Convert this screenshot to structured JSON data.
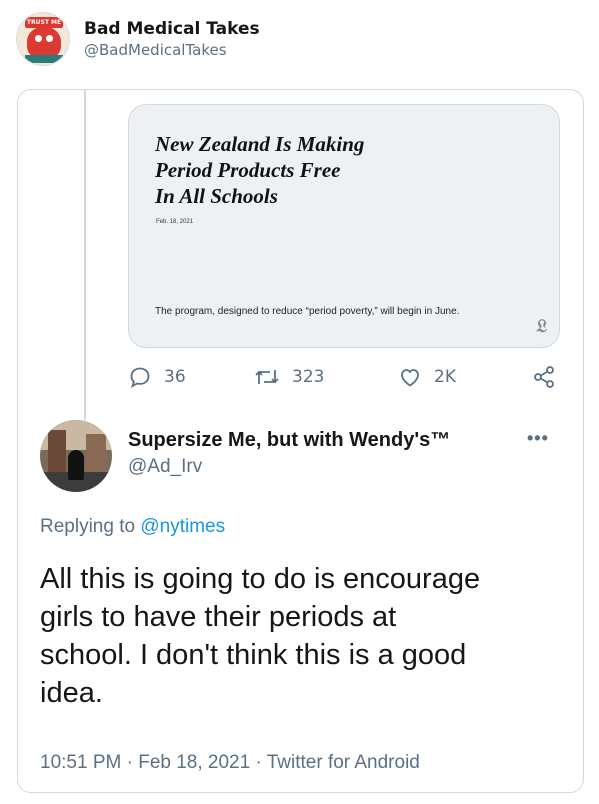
{
  "outer": {
    "name": "Bad Medical Takes",
    "handle": "@BadMedicalTakes",
    "avatar_cap_text": "TRUST ME"
  },
  "article": {
    "title_lines": [
      "New Zealand Is Making",
      "Period Products Free",
      "In All Schools"
    ],
    "date": "Feb. 18, 2021",
    "description": "The program, designed to reduce “period poverty,” will begin in June.",
    "logo": "𝔏"
  },
  "actions": {
    "replies": "36",
    "retweets": "323",
    "likes": "2K",
    "icons": [
      "reply-icon",
      "retweet-icon",
      "like-icon",
      "share-icon"
    ]
  },
  "reply": {
    "name": "Supersize Me, but with Wendy's™",
    "handle": "@Ad_Irv",
    "more": "•••",
    "replying_prefix": "Replying to",
    "replying_mention": "@nytimes",
    "body_lines": [
      "All this is going to do is encourage",
      "girls to have their periods at",
      "school. I don't think this is a good",
      "idea."
    ],
    "meta": "10:51 PM · Feb 18, 2021 · Twitter for Android"
  },
  "colors": {
    "secondary_text": "#5b7083",
    "link": "#1b95e0",
    "border": "#cfd9de"
  }
}
